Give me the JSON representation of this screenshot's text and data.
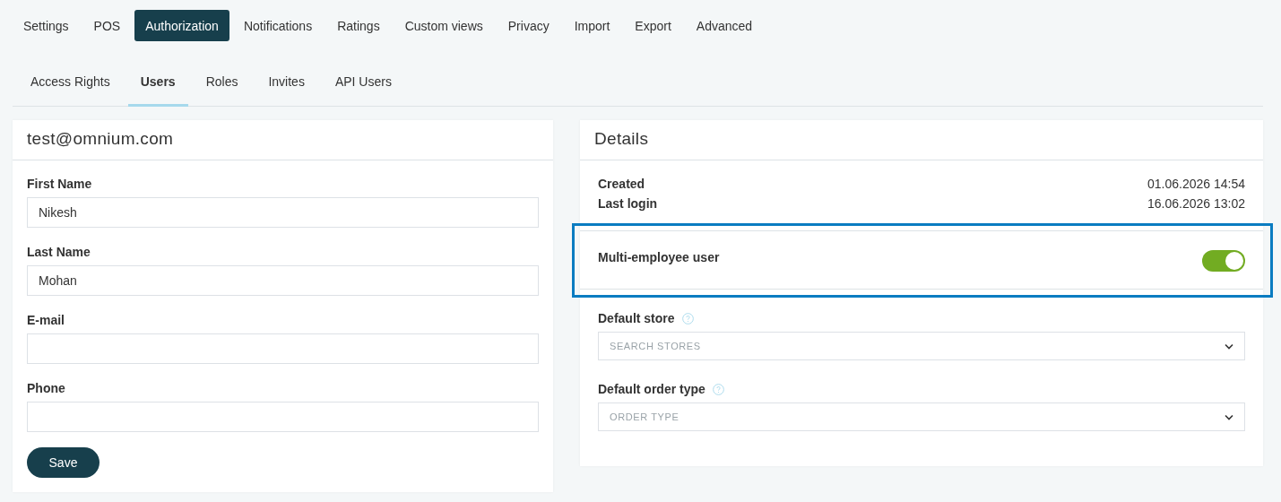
{
  "main_tabs": [
    {
      "label": "Settings",
      "selected": false
    },
    {
      "label": "POS",
      "selected": false
    },
    {
      "label": "Authorization",
      "selected": true
    },
    {
      "label": "Notifications",
      "selected": false
    },
    {
      "label": "Ratings",
      "selected": false
    },
    {
      "label": "Custom views",
      "selected": false
    },
    {
      "label": "Privacy",
      "selected": false
    },
    {
      "label": "Import",
      "selected": false
    },
    {
      "label": "Export",
      "selected": false
    },
    {
      "label": "Advanced",
      "selected": false
    }
  ],
  "sub_tabs": [
    {
      "label": "Access Rights",
      "selected": false
    },
    {
      "label": "Users",
      "selected": true
    },
    {
      "label": "Roles",
      "selected": false
    },
    {
      "label": "Invites",
      "selected": false
    },
    {
      "label": "API Users",
      "selected": false
    }
  ],
  "user_card": {
    "title": "test@omnium.com",
    "fields": [
      {
        "label": "First Name",
        "value": "Nikesh"
      },
      {
        "label": "Last Name",
        "value": "Mohan"
      },
      {
        "label": "E-mail"
      },
      {
        "label": "Phone"
      }
    ],
    "save_button": "Save"
  },
  "details_card": {
    "title": "Details",
    "info": [
      {
        "label": "Created",
        "value": "01.06.2026 14:54"
      },
      {
        "label": "Last login",
        "value": "16.06.2026 13:02"
      }
    ],
    "multi_employee": {
      "label": "Multi-employee user",
      "on": true,
      "highlighted": true
    },
    "selects": [
      {
        "label": "Default store",
        "placeholder": "SEARCH STORES"
      },
      {
        "label": "Default order type",
        "placeholder": "ORDER TYPE"
      }
    ]
  }
}
